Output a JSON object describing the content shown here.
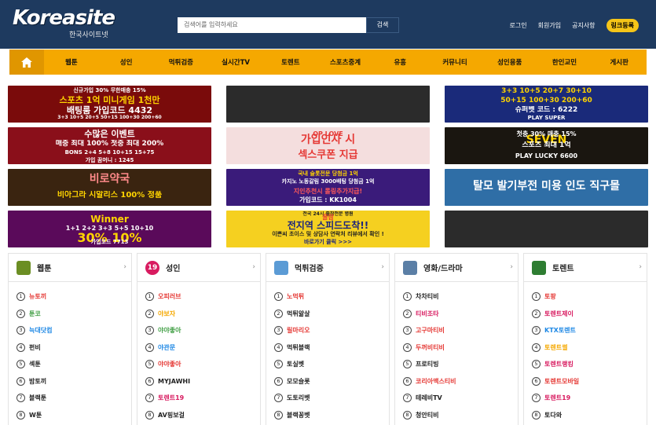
{
  "header": {
    "logo_text": "Koreasite",
    "logo_sub": "한국사이트넷",
    "search_placeholder": "검색어를 입력하세요",
    "search_button": "검색",
    "links": [
      "로그인",
      "회원가입",
      "공지사항"
    ],
    "register_link": "링크등록"
  },
  "nav": {
    "items": [
      "웹툰",
      "성인",
      "먹튀검증",
      "실시간TV",
      "토렌트",
      "스포츠중계",
      "유흥",
      "커뮤니티",
      "성인용품",
      "한인교민",
      "게시판"
    ]
  },
  "banners": [
    {
      "lines": [
        "신규가입 30% 무한매충 15%",
        "스포츠 1억 미니게임 1천만",
        "배팅룸 가입코드 4432",
        "3+3 10+5 20+5 50+15 100+30 200+60"
      ],
      "bg": "#7a0b0b"
    },
    {
      "lines": [],
      "bg": "#2b2b2b"
    },
    {
      "lines": [
        "3+3 10+5 20+7 30+10",
        "50+15 100+30 200+60",
        "슈퍼벳 코드 : 6222",
        "PLAY SUPER"
      ],
      "bg": "#1a2a7a"
    },
    {
      "lines": [
        "수많은 이벤트",
        "매충 최대 100% 첫충 최대 200%",
        "BONS 2+4 5+8 10+15 15+75",
        "가입 꿈머니 : 1245"
      ],
      "bg": "#8a0f1a"
    },
    {
      "lines": [
        "OP LOVE",
        "가입인사 시",
        "섹스쿠폰 지급"
      ],
      "bg": "#f4dede"
    },
    {
      "lines": [
        "SEVEN",
        "첫충 30% 매충 15%",
        "스포츠 최대 1억",
        "PLAY LUCKY 6600"
      ],
      "bg": "#1a1610"
    },
    {
      "lines": [
        "비로약국",
        "비아그라 시알리스 100% 정품"
      ],
      "bg": "#3a2410"
    },
    {
      "lines": [
        "국내 슬롯전문 당첨금 1억",
        "카지노 노동갈림 3000배팅 당첨금 1억",
        "지인추천시 롤링추가지급!",
        "가입코드 : KK1004"
      ],
      "bg": "#3a1b7a"
    },
    {
      "lines": [
        "탈모 발기부전 미용 인도 직구몰"
      ],
      "bg": "#2f6ea6"
    },
    {
      "lines": [
        "Winner",
        "1+1 2+2 3+3 5+5 10+10",
        "30% 10%",
        "가입코드 7713"
      ],
      "bg": "#5a0a5a"
    },
    {
      "lines": [
        "전국 24시 출장전문 병원",
        "꿀잠",
        "전지역 스피드도착!!",
        "이쁜씨 초이스 및 상담사 연락처 리뷰에서 확인 !",
        "바로가기 클릭 >>>"
      ],
      "bg": "#f5d020"
    },
    {
      "lines": [],
      "bg": "#2b2b2b"
    }
  ],
  "cards": [
    {
      "title": "웹툰",
      "icon": "webtoon-icon",
      "iconColor": "#6b8e23",
      "items": [
        {
          "n": "1",
          "t": "뉴토끼",
          "c": "#e53935"
        },
        {
          "n": "2",
          "t": "툰코",
          "c": "#43a047"
        },
        {
          "n": "3",
          "t": "늑대닷컴",
          "c": "#1e88e5"
        },
        {
          "n": "4",
          "t": "펀비",
          "c": "#222222"
        },
        {
          "n": "5",
          "t": "섹툰",
          "c": "#222222"
        },
        {
          "n": "6",
          "t": "밤토끼",
          "c": "#222222"
        },
        {
          "n": "7",
          "t": "블랙툰",
          "c": "#222222"
        },
        {
          "n": "8",
          "t": "W툰",
          "c": "#222222"
        }
      ]
    },
    {
      "title": "성인",
      "icon": "adult-19-icon",
      "iconColor": "#d81b60",
      "iconText": "19",
      "items": [
        {
          "n": "1",
          "t": "오피러브",
          "c": "#e53935"
        },
        {
          "n": "2",
          "t": "야보자",
          "c": "#f5a800"
        },
        {
          "n": "3",
          "t": "야야좋아",
          "c": "#43a047"
        },
        {
          "n": "4",
          "t": "야관문",
          "c": "#1e88e5"
        },
        {
          "n": "5",
          "t": "야야좋아",
          "c": "#e53935"
        },
        {
          "n": "6",
          "t": "MYJAWHI",
          "c": "#222222"
        },
        {
          "n": "7",
          "t": "토렌트19",
          "c": "#d81b60"
        },
        {
          "n": "8",
          "t": "AV핑보걸",
          "c": "#222222"
        }
      ]
    },
    {
      "title": "먹튀검증",
      "icon": "magnifier-icon",
      "iconColor": "#5b9bd5",
      "items": [
        {
          "n": "1",
          "t": "노먹튀",
          "c": "#e53935"
        },
        {
          "n": "2",
          "t": "먹튀앎살",
          "c": "#222222"
        },
        {
          "n": "3",
          "t": "릴마리오",
          "c": "#e53935"
        },
        {
          "n": "4",
          "t": "먹튀블랙",
          "c": "#222222"
        },
        {
          "n": "5",
          "t": "토실벳",
          "c": "#222222"
        },
        {
          "n": "6",
          "t": "모모슬롯",
          "c": "#222222"
        },
        {
          "n": "7",
          "t": "도토리벳",
          "c": "#222222"
        },
        {
          "n": "8",
          "t": "블랙꽁벳",
          "c": "#222222"
        }
      ]
    },
    {
      "title": "영화/드라마",
      "icon": "tv-icon",
      "iconColor": "#5b7fa6",
      "items": [
        {
          "n": "1",
          "t": "차차티비",
          "c": "#222222"
        },
        {
          "n": "2",
          "t": "티비조타",
          "c": "#d81b60"
        },
        {
          "n": "3",
          "t": "고구마티비",
          "c": "#e53935"
        },
        {
          "n": "4",
          "t": "두꺼비티비",
          "c": "#e53935"
        },
        {
          "n": "5",
          "t": "프로티빙",
          "c": "#222222"
        },
        {
          "n": "6",
          "t": "코리아맥스티비",
          "c": "#e53935"
        },
        {
          "n": "7",
          "t": "테레비TV",
          "c": "#222222"
        },
        {
          "n": "8",
          "t": "청안티비",
          "c": "#222222"
        }
      ]
    },
    {
      "title": "토렌트",
      "icon": "torrent-icon",
      "iconColor": "#2e7d32",
      "items": [
        {
          "n": "1",
          "t": "토팡",
          "c": "#e53935"
        },
        {
          "n": "2",
          "t": "토렌트제이",
          "c": "#d81b60"
        },
        {
          "n": "3",
          "t": "KTX토렌트",
          "c": "#1e88e5"
        },
        {
          "n": "4",
          "t": "토렌트썰",
          "c": "#f5a800"
        },
        {
          "n": "5",
          "t": "토렌트랭킹",
          "c": "#d81b60"
        },
        {
          "n": "6",
          "t": "토렌트모바일",
          "c": "#e53935"
        },
        {
          "n": "7",
          "t": "토렌트19",
          "c": "#d81b60"
        },
        {
          "n": "8",
          "t": "토다와",
          "c": "#222222"
        }
      ]
    }
  ]
}
